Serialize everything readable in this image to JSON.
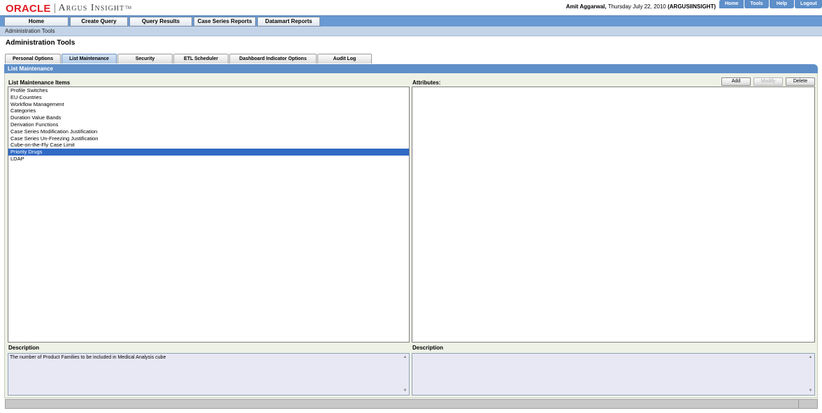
{
  "header": {
    "logo_oracle": "ORACLE",
    "logo_product": "Argus Insight",
    "logo_tm": "TM",
    "user_name": "Amit Aggarwal,",
    "date": "Thursday July 22, 2010",
    "server": "(ARGUSIINSIGHT)",
    "top_links": [
      "Home",
      "Tools",
      "Help",
      "Logout"
    ]
  },
  "nav": {
    "items": [
      "Home",
      "Create Query",
      "Query Results",
      "Case Series Reports",
      "Datamart Reports"
    ]
  },
  "breadcrumb": "Administration Tools",
  "page_title": "Administration Tools",
  "tabs": {
    "items": [
      "Personal Options",
      "List Maintenance",
      "Security",
      "ETL Scheduler",
      "Dashboard Indicator Options",
      "Audit Log"
    ],
    "active": "List Maintenance"
  },
  "panel_title": "List Maintenance",
  "list": {
    "label": "List Maintenance Items",
    "items": [
      "Profile Switches",
      "EU Countries",
      "Workflow Management",
      "Categories",
      "Duration Value Bands",
      "Derivation Functions",
      "Case Series Modification Justification",
      "Case Series Un-Freezing Justification",
      "Cube-on-the-Fly Case Limit",
      "Priority Drugs",
      "LDAP"
    ],
    "selected": "Priority Drugs"
  },
  "attributes": {
    "label": "Attributes:",
    "buttons": {
      "add": "Add",
      "modify": "Modify",
      "delete": "Delete"
    }
  },
  "descriptions": {
    "left_label": "Description",
    "left_text": "The number of Product Families to be included in Medical Analysis cube",
    "right_label": "Description",
    "right_text": ""
  },
  "colors": {
    "nav_blue": "#6a9ad3",
    "panel_blue": "#5f8fc8",
    "selection": "#316ac5",
    "oracle_red": "#e01b22"
  }
}
